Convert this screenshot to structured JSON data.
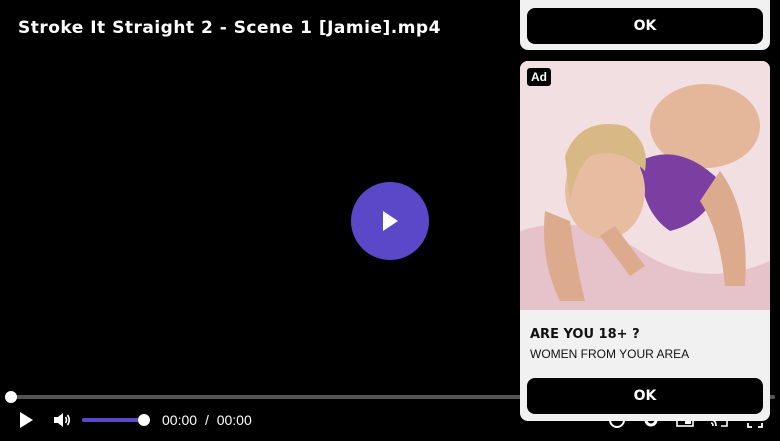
{
  "player": {
    "title": "Stroke It Straight 2 - Scene 1 [Jamie].mp4",
    "progress": 0.0,
    "volume": 1.0,
    "current_time": "00:00",
    "separator": "/",
    "duration": "00:00",
    "accent_color": "#5b48c8"
  },
  "ads": {
    "top_ok_label": "OK",
    "card": {
      "badge": "Ad",
      "headline": "ARE YOU 18+ ?",
      "subtext": "WOMEN FROM YOUR AREA",
      "ok_label": "OK"
    }
  },
  "icons": {
    "big_play": "play-icon",
    "play": "play-icon",
    "volume": "volume-icon",
    "settings": "gear-icon",
    "cast": "cast-icon",
    "fullscreen": "fullscreen-icon"
  }
}
